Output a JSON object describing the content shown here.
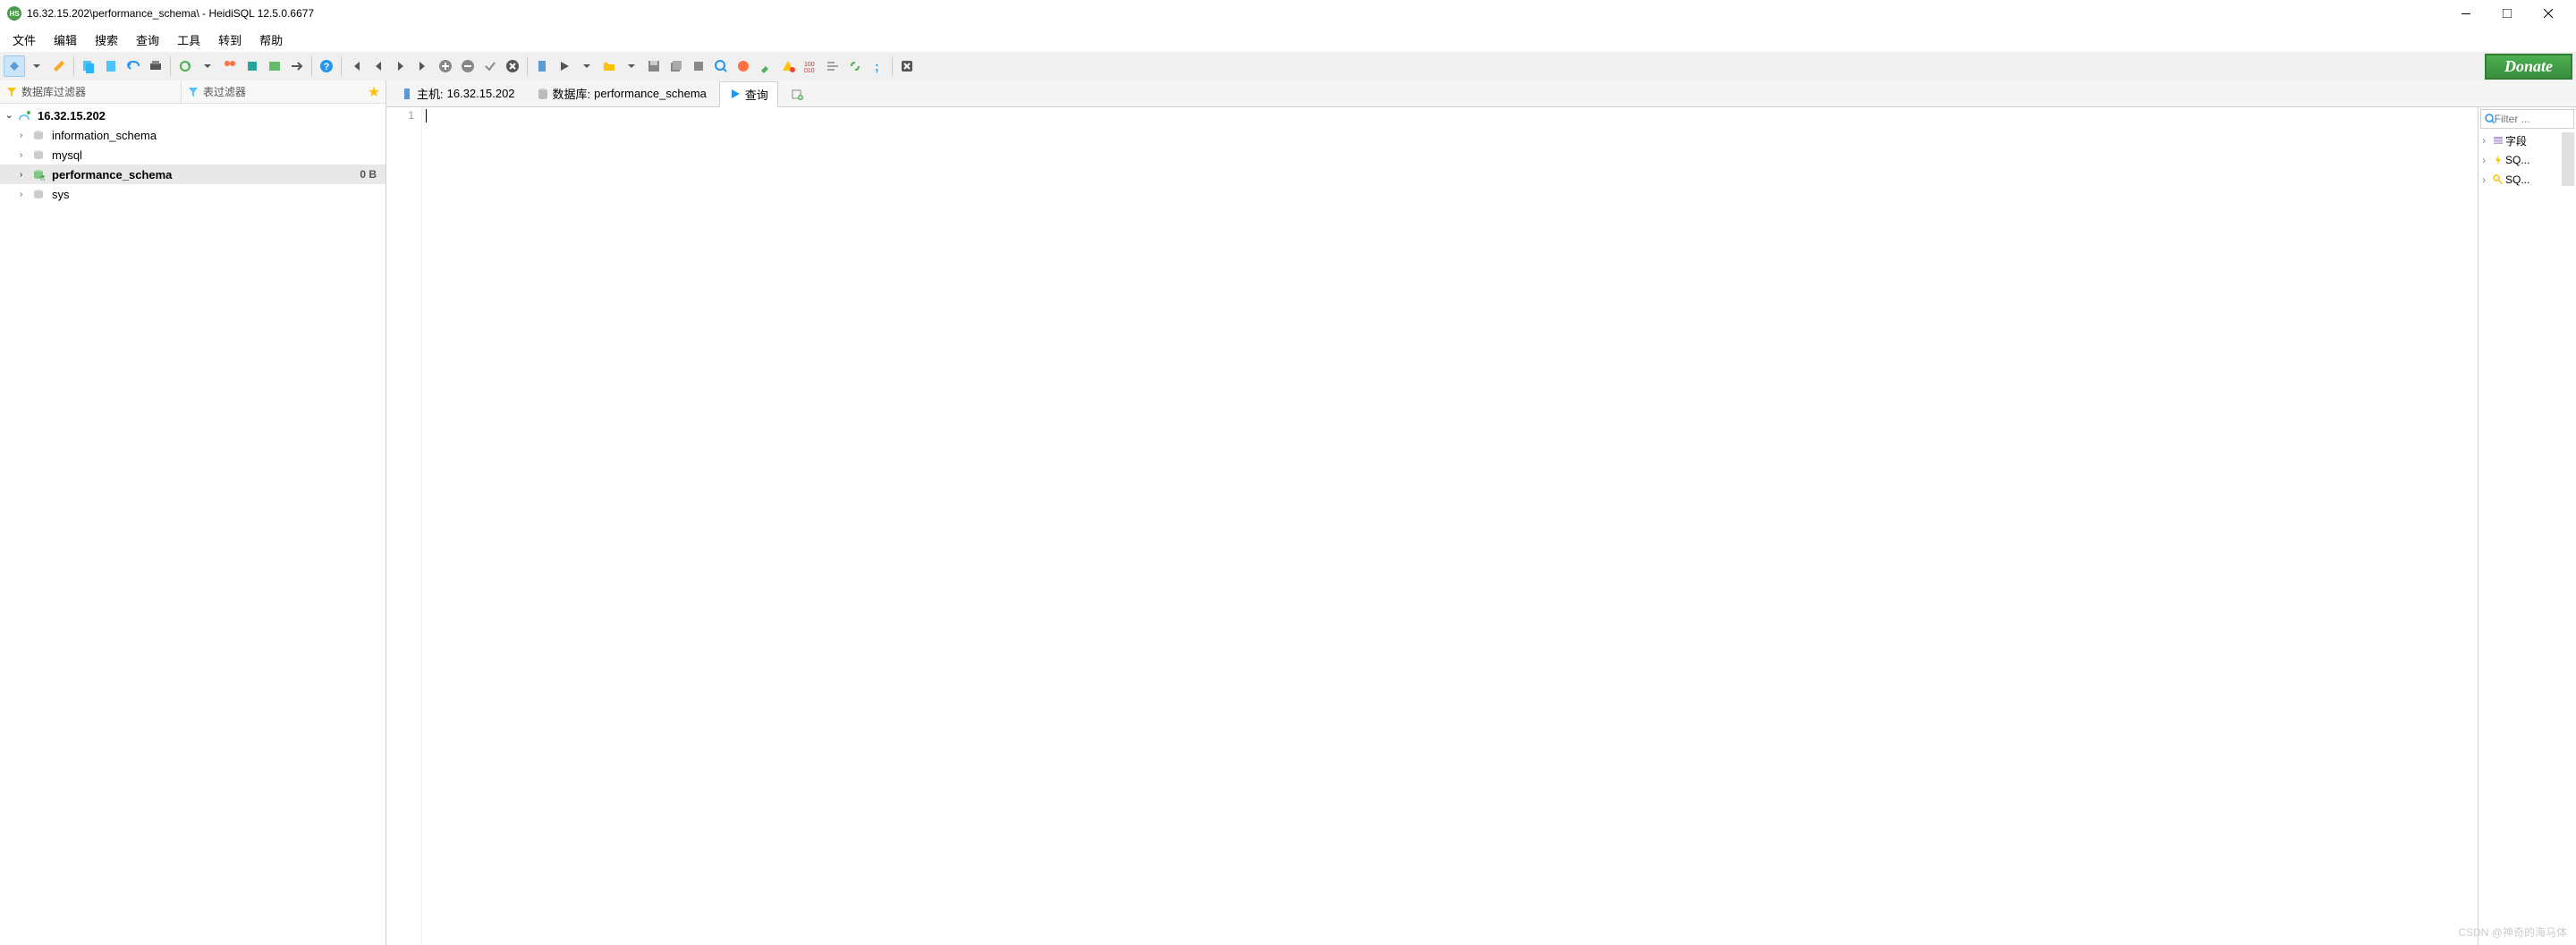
{
  "window": {
    "title": "16.32.15.202\\performance_schema\\ - HeidiSQL 12.5.0.6677"
  },
  "menu": {
    "items": [
      "文件",
      "编辑",
      "搜索",
      "查询",
      "工具",
      "转到",
      "帮助"
    ]
  },
  "toolbar": {
    "donate": "Donate"
  },
  "sidebar": {
    "filter_db": "数据库过滤器",
    "filter_tbl": "表过滤器",
    "server": {
      "name": "16.32.15.202",
      "children": [
        {
          "name": "information_schema",
          "size": ""
        },
        {
          "name": "mysql",
          "size": ""
        },
        {
          "name": "performance_schema",
          "size": "0 B",
          "selected": true
        },
        {
          "name": "sys",
          "size": ""
        }
      ]
    }
  },
  "tabs": {
    "host_label": "主机:",
    "host_value": "16.32.15.202",
    "db_label": "数据库:",
    "db_value": "performance_schema",
    "query_label": "查询"
  },
  "editor": {
    "line_number": "1"
  },
  "right_panel": {
    "filter_placeholder": "Filter ...",
    "items": [
      "字段",
      "SQ...",
      "SQ..."
    ]
  },
  "watermark": "CSDN @神奇的海马体"
}
